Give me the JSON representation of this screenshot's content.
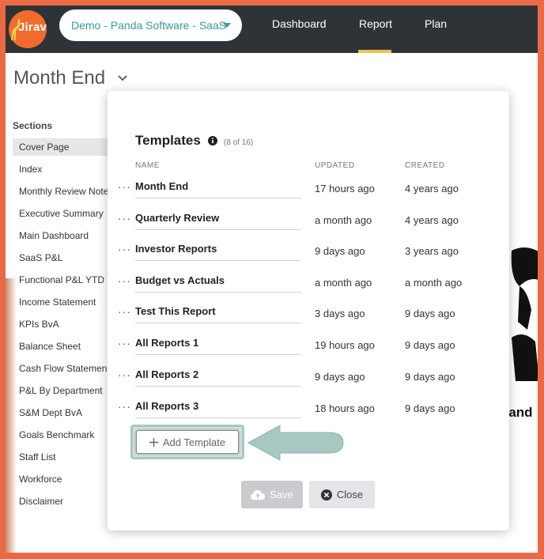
{
  "brand": {
    "logo_text": "Jirav"
  },
  "company_selector": {
    "value": "Demo - Panda Software - SaaS"
  },
  "nav": {
    "items": [
      {
        "label": "Dashboard"
      },
      {
        "label": "Report"
      },
      {
        "label": "Plan"
      }
    ],
    "active": "Report"
  },
  "page": {
    "title": "Month End"
  },
  "sections": {
    "heading": "Sections",
    "items": [
      {
        "label": "Cover Page"
      },
      {
        "label": "Index"
      },
      {
        "label": "Monthly Review Note"
      },
      {
        "label": "Executive Summary"
      },
      {
        "label": "Main Dashboard"
      },
      {
        "label": "SaaS P&L"
      },
      {
        "label": "Functional P&L YTD"
      },
      {
        "label": "Income Statement"
      },
      {
        "label": "KPIs BvA"
      },
      {
        "label": "Balance Sheet"
      },
      {
        "label": "Cash Flow Statemen"
      },
      {
        "label": "P&L By Department"
      },
      {
        "label": "S&M Dept BvA"
      },
      {
        "label": "Goals Benchmark"
      },
      {
        "label": "Staff List"
      },
      {
        "label": "Workforce"
      },
      {
        "label": "Disclaimer"
      }
    ]
  },
  "background_preview": {
    "text": "Pand"
  },
  "modal": {
    "title": "Templates",
    "count": "(8 of 16)",
    "columns": {
      "name": "NAME",
      "updated": "UPDATED",
      "created": "CREATED"
    },
    "rows": [
      {
        "menu": "···",
        "name": "Month End",
        "updated": "17 hours ago",
        "created": "4 years ago"
      },
      {
        "menu": "···",
        "name": "Quarterly Review",
        "updated": "a month ago",
        "created": "4 years ago"
      },
      {
        "menu": "···",
        "name": "Investor Reports",
        "updated": "9 days ago",
        "created": "3 years ago"
      },
      {
        "menu": "···",
        "name": "Budget vs Actuals",
        "updated": "a month ago",
        "created": "a month ago"
      },
      {
        "menu": "···",
        "name": "Test This Report",
        "updated": "3 days ago",
        "created": "9 days ago"
      },
      {
        "menu": "···",
        "name": "All Reports 1",
        "updated": "19 hours ago",
        "created": "9 days ago"
      },
      {
        "menu": "···",
        "name": "All Reports 2",
        "updated": "9 days ago",
        "created": "9 days ago"
      },
      {
        "menu": "···",
        "name": "All Reports 3",
        "updated": "18 hours ago",
        "created": "9 days ago"
      }
    ],
    "add_button": "Add Template",
    "save_button": "Save",
    "close_button": "Close"
  },
  "colors": {
    "topbar": "#2e3338",
    "accent": "#3a9b9b",
    "brand_orange": "#f26b2d",
    "nav_underline": "#f2c14e",
    "highlight_arrow": "#a8c7c3"
  }
}
